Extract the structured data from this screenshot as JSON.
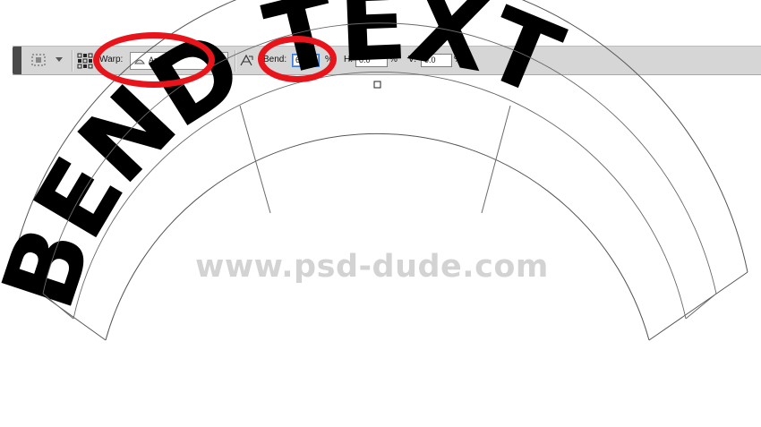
{
  "toolbar": {
    "warp_label": "Warp:",
    "warp_style": "Arc",
    "bend_label": "Bend:",
    "bend_value": "60",
    "bend_unit": "%",
    "h_label": "H:",
    "h_value": "0.0",
    "h_unit": "%",
    "v_label": "V:",
    "v_value": "0.0",
    "v_unit": "%"
  },
  "artwork": {
    "text": "BEND TEXT",
    "watermark": "www.psd-dude.com"
  },
  "colors": {
    "callout": "#e8141b",
    "text": "#000000",
    "toolbar": "#d6d6d6"
  },
  "icons": [
    "tool-preset-icon",
    "dropdown-caret-icon",
    "warp-grid-icon",
    "warp-style-icon",
    "change-orientation-icon"
  ]
}
